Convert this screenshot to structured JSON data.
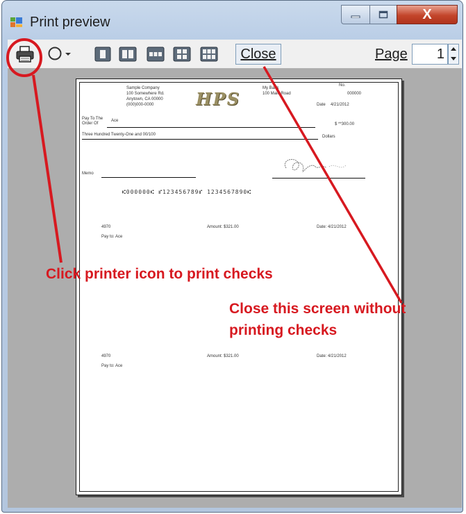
{
  "window": {
    "title": "Print preview",
    "app_icon": "print-preview-app-icon",
    "controls": {
      "minimize_icon": "minimize-icon",
      "maximize_icon": "maximize-icon",
      "close_label": "X"
    }
  },
  "toolbar": {
    "print_icon": "printer-icon",
    "zoom_icon": "zoom-icon",
    "page_layout_icons": [
      "one-page-icon",
      "two-pages-icon",
      "three-pages-icon",
      "four-pages-icon",
      "six-pages-icon"
    ],
    "close_label": "Close",
    "page_label": "Page",
    "page_value": "1"
  },
  "check": {
    "company_name": "Sample Company",
    "company_address": "100 Somewhere Rd.",
    "company_city": "Anytown, CA 00000",
    "company_phone": "(000)000-0000",
    "logo": "HPS",
    "bank_name": "My Bank",
    "bank_address": "100 Main Road",
    "no_label": "No.",
    "check_number": "000000",
    "date_label": "Date",
    "date_value": "4/21/2012",
    "pay_to_label": "Pay To The",
    "order_of_label": "Order Of",
    "payee": "Ace",
    "amount_box": "$ **300.00",
    "amount_words": "Three Hundred Twenty-One and 00/100",
    "dollars_label": "Dollars",
    "memo_label": "Memo",
    "micr_line": "⑆000000⑆ ⑈123456789⑈ 1234567890⑆",
    "stub1": {
      "number": "4970",
      "payee": "Pay to: Ace",
      "amount": "Amount: $321.00",
      "date": "Date: 4/21/2012"
    },
    "stub2": {
      "number": "4970",
      "payee": "Pay to: Ace",
      "amount": "Amount: $321.00",
      "date": "Date: 4/21/2012"
    }
  },
  "annotations": {
    "print_hint": "Click printer icon to print checks",
    "close_hint_line1": "Close this screen without",
    "close_hint_line2": "printing checks",
    "color": "#d71920"
  }
}
